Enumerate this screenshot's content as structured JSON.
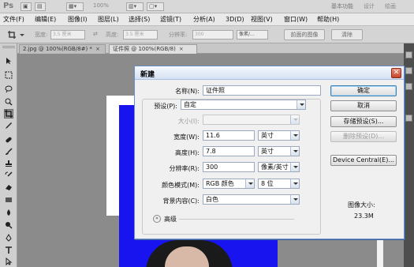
{
  "appbar": {
    "logo": "Ps",
    "zoom": "100%",
    "workspaces": [
      "基本功能",
      "设计",
      "绘画"
    ]
  },
  "menu": [
    "文件(F)",
    "编辑(E)",
    "图像(I)",
    "图层(L)",
    "选择(S)",
    "滤镜(T)",
    "分析(A)",
    "3D(D)",
    "视图(V)",
    "窗口(W)",
    "帮助(H)"
  ],
  "options": {
    "width_label": "宽度:",
    "width_placeholder": "3.5 厘米",
    "height_label": "高度:",
    "height_placeholder": "3.5 厘米",
    "resolution_label": "分辨率:",
    "resolution_value": "300",
    "unit_value": "像素/...",
    "front_image_btn": "前面的图像",
    "clear_btn": "清除"
  },
  "tabs": [
    {
      "label": "2.jpg @ 100%(RGB/8#) *",
      "close": "×"
    },
    {
      "label": "证件照 @ 100%(RGB/8)",
      "close": "×"
    }
  ],
  "dialog": {
    "title": "新建",
    "close": "✕",
    "name_label": "名称(N):",
    "name_value": "证件照",
    "preset_label": "预设(P):",
    "preset_value": "自定",
    "size_label": "大小(I):",
    "width_label": "宽度(W):",
    "width_value": "11.6",
    "width_unit": "英寸",
    "height_label": "高度(H):",
    "height_value": "7.8",
    "height_unit": "英寸",
    "resolution_label": "分辨率(R):",
    "resolution_value": "300",
    "resolution_unit": "像素/英寸",
    "colormode_label": "颜色模式(M):",
    "colormode_value": "RGB 颜色",
    "bitdepth_value": "8 位",
    "background_label": "背景内容(C):",
    "background_value": "白色",
    "advanced_label": "高级",
    "advanced_icon": "»",
    "ok_btn": "确定",
    "cancel_btn": "取消",
    "save_preset_btn": "存储预设(S)...",
    "delete_preset_btn": "删除预设(D)...",
    "device_central_btn": "Device Central(E)...",
    "image_size_label": "图像大小:",
    "image_size_value": "23.3M"
  }
}
